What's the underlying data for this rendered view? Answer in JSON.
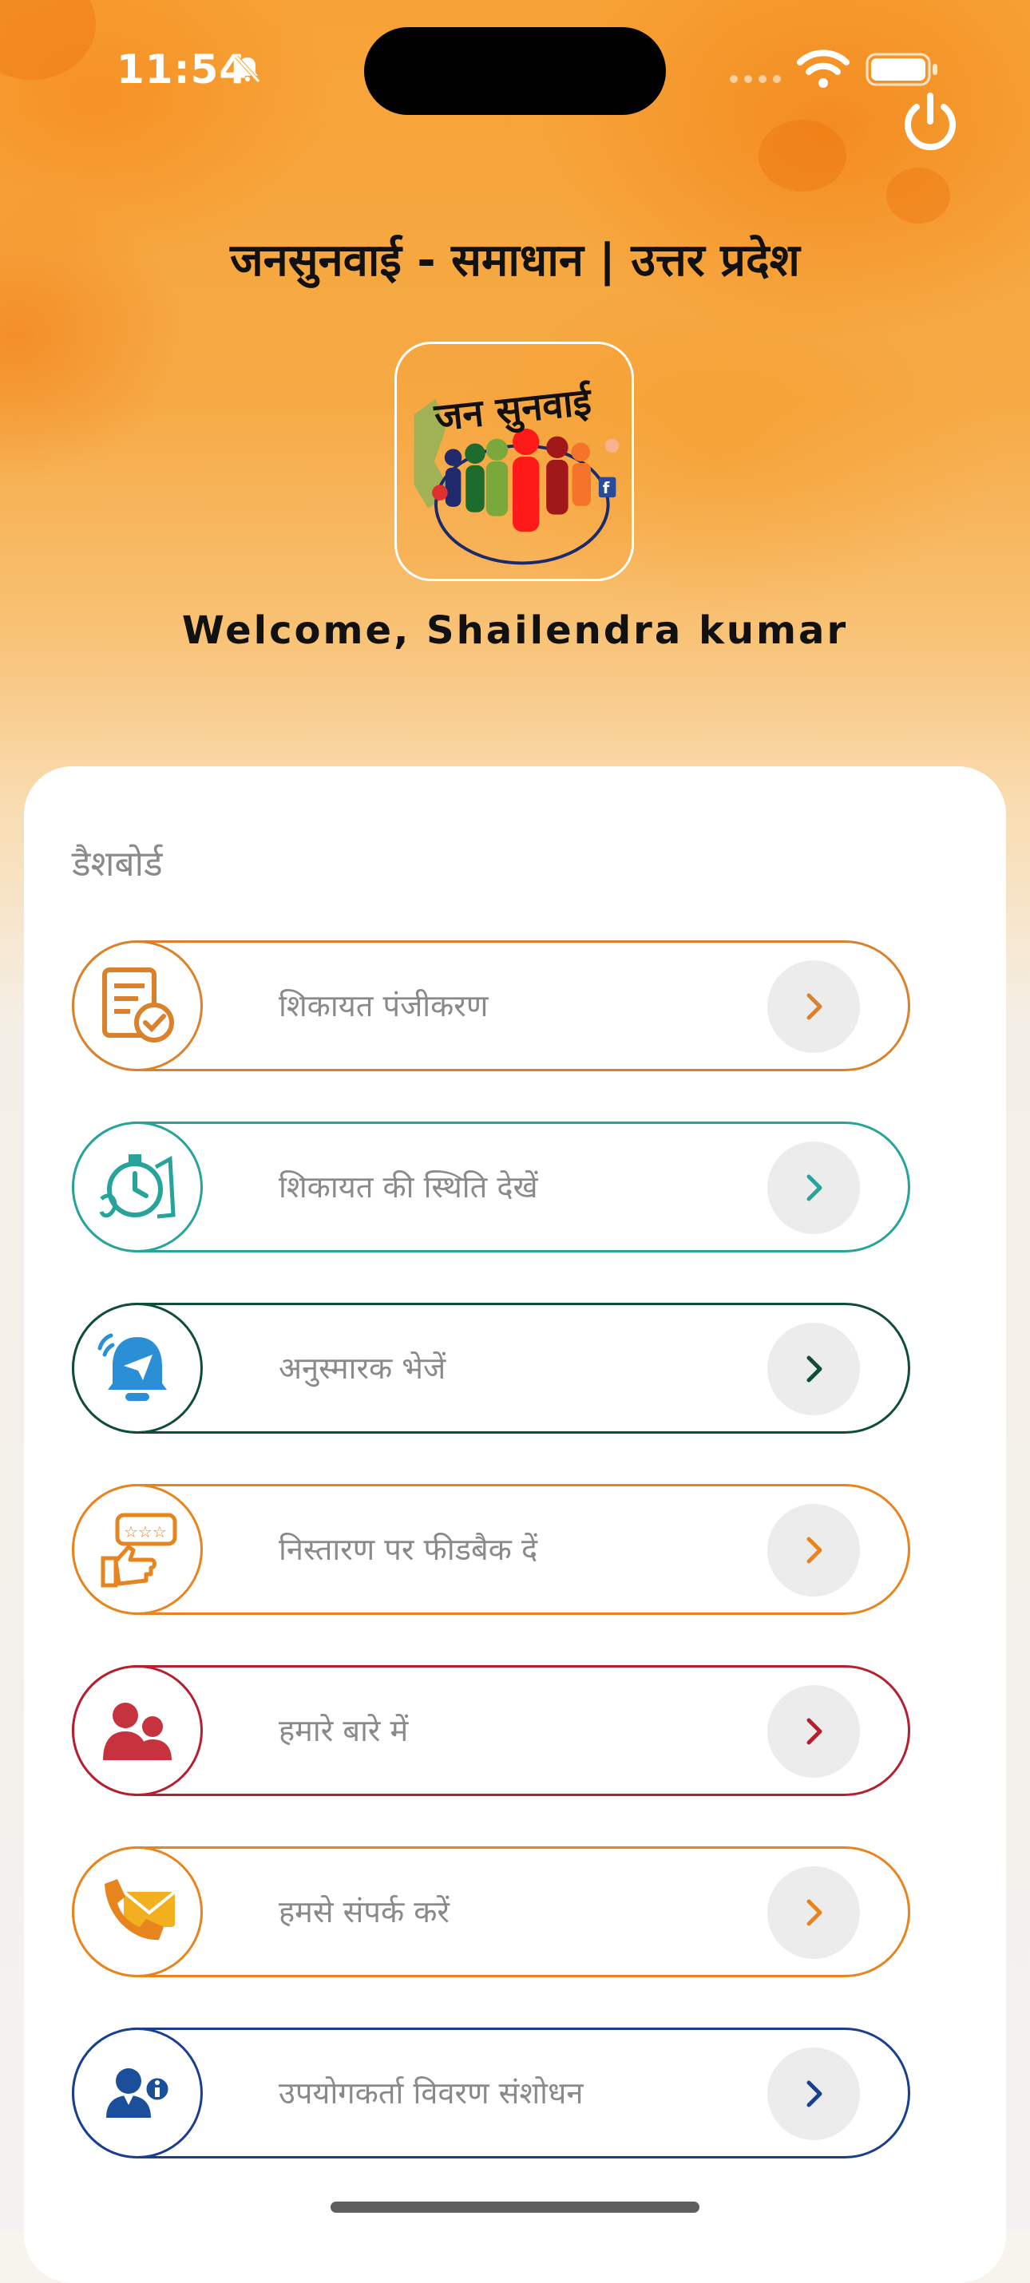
{
  "status_bar": {
    "time": "11:54"
  },
  "header": {
    "title": "जनसुनवाई - समाधान | उत्तर प्रदेश",
    "logo_text": "जन सुनवाई",
    "welcome": "Welcome, Shailendra kumar"
  },
  "dashboard": {
    "title": "डैशबोर्ड",
    "items": [
      {
        "label": "शिकायत पंजीकरण",
        "color": "#d9822b",
        "icon": "complaint-register-icon"
      },
      {
        "label": "शिकायत की स्थिति देखें",
        "color": "#26a39a",
        "icon": "stopwatch-status-icon"
      },
      {
        "label": "अनुस्मारक भेजें",
        "color": "#0f4d3a",
        "icon": "reminder-bell-icon"
      },
      {
        "label": "निस्तारण पर फीडबैक दें",
        "color": "#e8841e",
        "icon": "feedback-thumbs-up-icon"
      },
      {
        "label": "हमारे बारे में",
        "color": "#b5202e",
        "icon": "about-us-people-icon"
      },
      {
        "label": "हमसे संपर्क करें",
        "color": "#e8841e",
        "icon": "contact-phone-mail-icon"
      },
      {
        "label": "उपयोगकर्ता विवरण संशोधन",
        "color": "#1b3f8f",
        "icon": "user-info-icon"
      }
    ]
  }
}
